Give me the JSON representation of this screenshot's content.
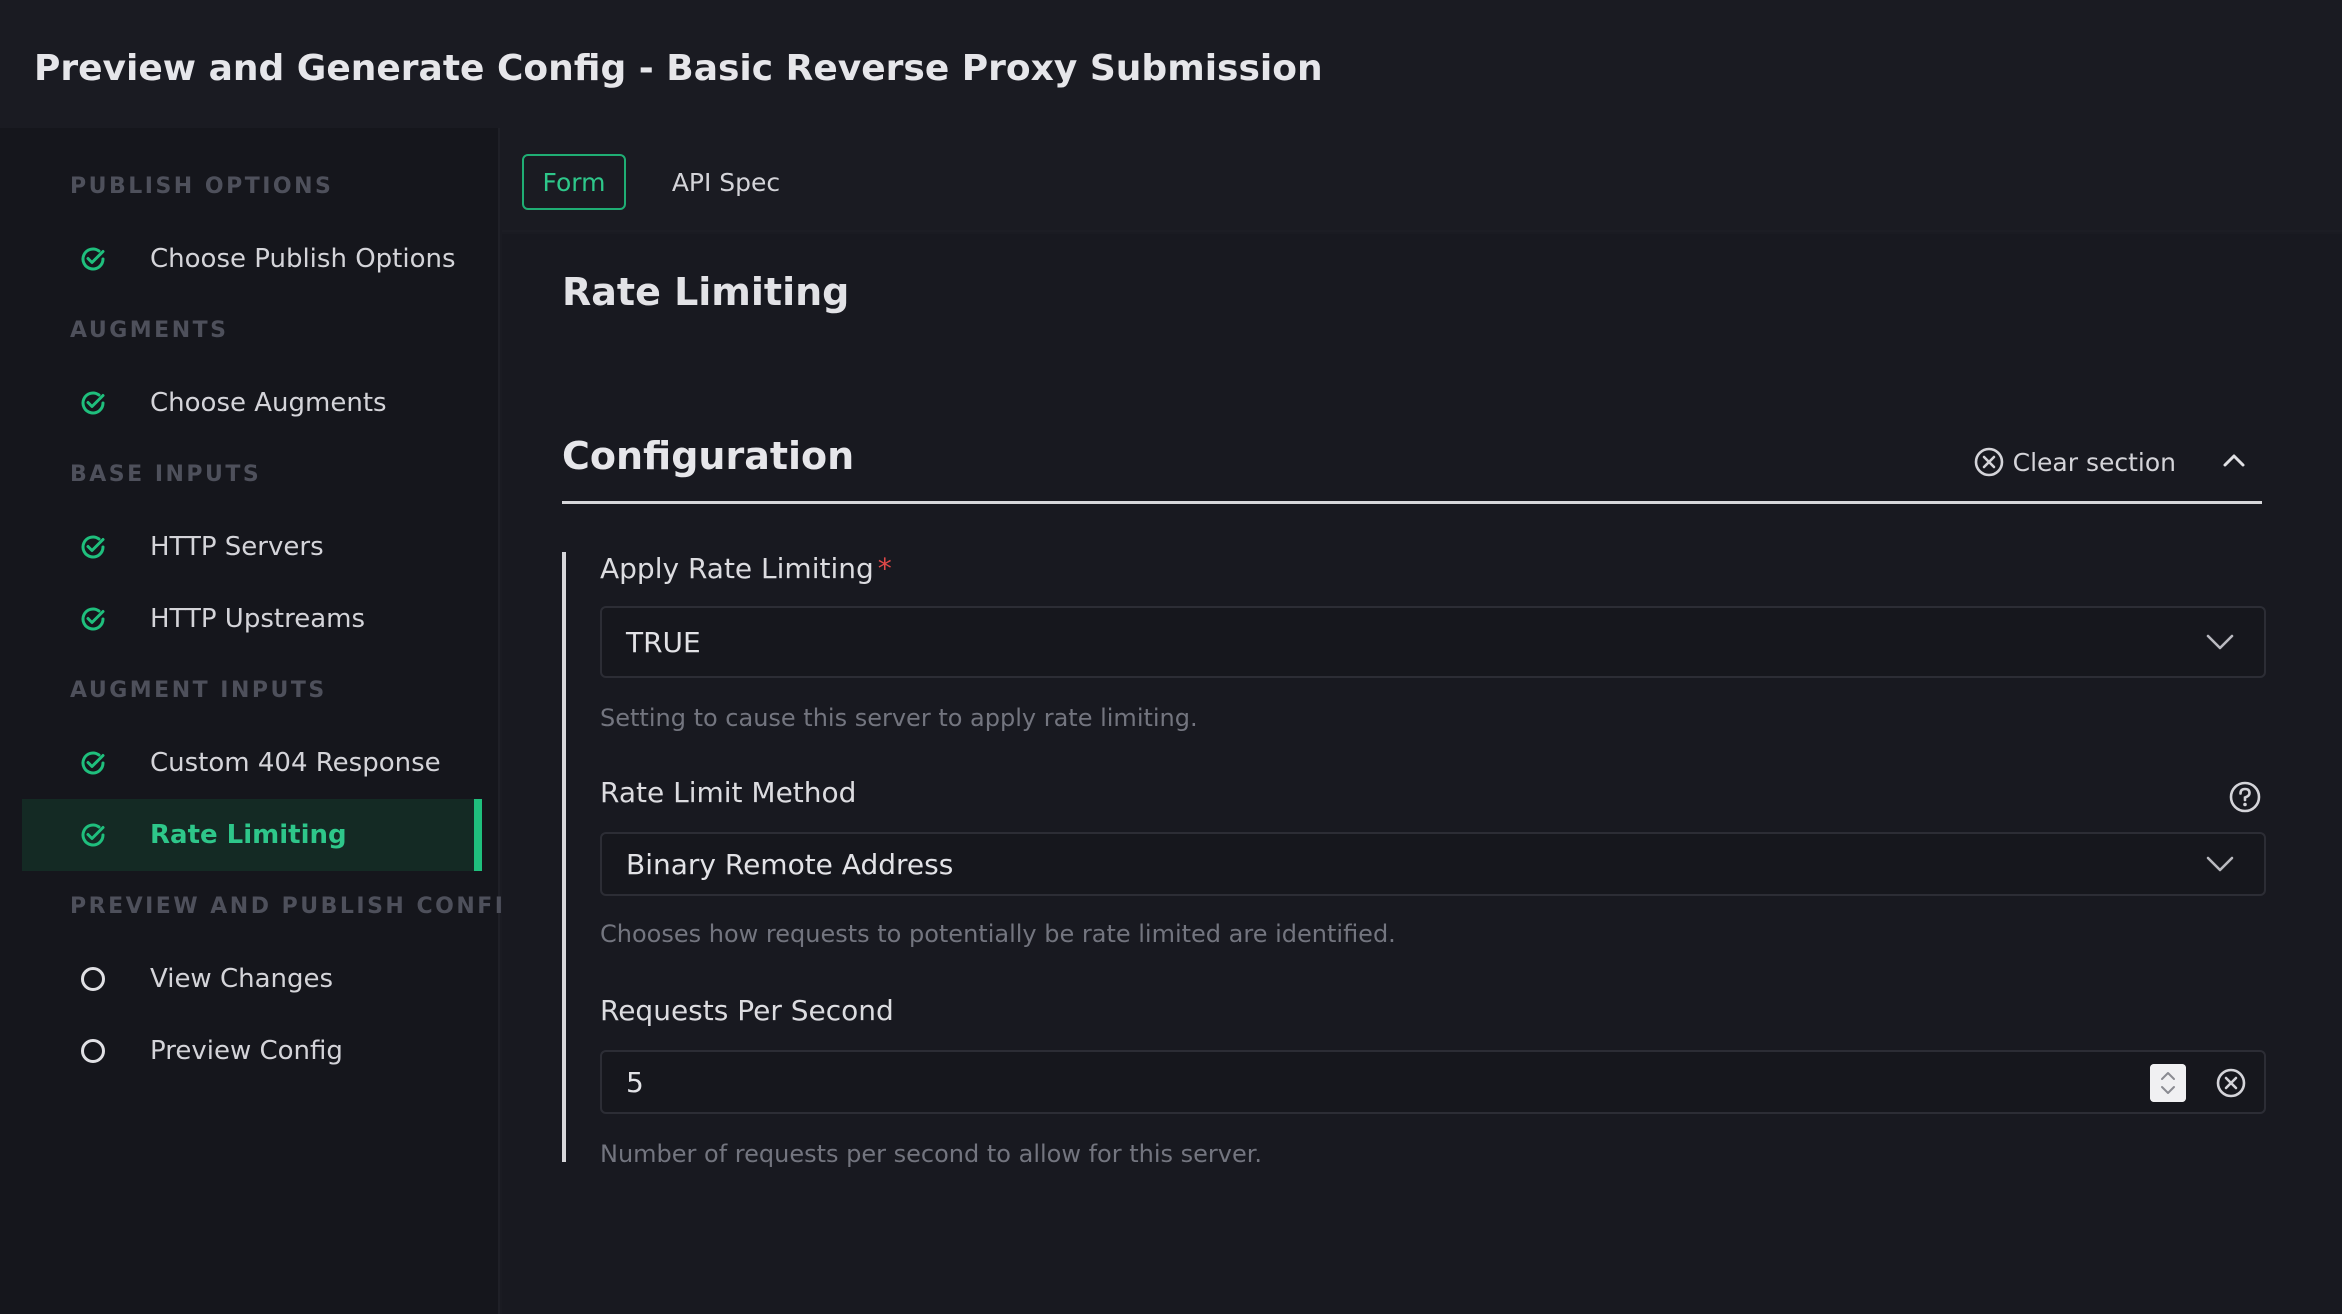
{
  "header": {
    "title": "Preview and Generate Config - Basic Reverse Proxy Submission"
  },
  "sidebar": {
    "sections": [
      {
        "label": "PUBLISH OPTIONS"
      },
      {
        "label": "AUGMENTS"
      },
      {
        "label": "BASE INPUTS"
      },
      {
        "label": "AUGMENT INPUTS"
      },
      {
        "label": "PREVIEW AND PUBLISH CONFIG"
      }
    ],
    "items": [
      {
        "label": "Choose Publish Options",
        "status": "complete"
      },
      {
        "label": "Choose Augments",
        "status": "complete"
      },
      {
        "label": "HTTP Servers",
        "status": "complete"
      },
      {
        "label": "HTTP Upstreams",
        "status": "complete"
      },
      {
        "label": "Custom 404 Response",
        "status": "complete"
      },
      {
        "label": "Rate Limiting",
        "status": "complete",
        "active": true
      },
      {
        "label": "View Changes",
        "status": "pending"
      },
      {
        "label": "Preview Config",
        "status": "pending"
      }
    ]
  },
  "tabs": [
    {
      "label": "Form",
      "active": true
    },
    {
      "label": "API Spec",
      "active": false
    }
  ],
  "main": {
    "heading": "Rate Limiting",
    "section": {
      "title": "Configuration",
      "clear_label": "Clear section"
    },
    "fields": {
      "apply_rate_limiting": {
        "label": "Apply Rate Limiting",
        "required_mark": "*",
        "value": "TRUE",
        "description": "Setting to cause this server to apply rate limiting."
      },
      "rate_limit_method": {
        "label": "Rate Limit Method",
        "value": "Binary Remote Address",
        "description": "Chooses how requests to potentially be rate limited are identified."
      },
      "requests_per_second": {
        "label": "Requests Per Second",
        "value": "5",
        "description": "Number of requests per second to allow for this server."
      }
    }
  },
  "colors": {
    "accent": "#1fbf7d",
    "background": "#1a1b22",
    "sidebar": "#15161c",
    "required": "#e04848"
  },
  "icons": {
    "complete": "check-circle-icon",
    "pending": "empty-circle-icon",
    "clear": "close-circle-icon",
    "collapse": "chevron-up-icon",
    "dropdown": "chevron-down-icon",
    "help": "question-circle-icon"
  }
}
